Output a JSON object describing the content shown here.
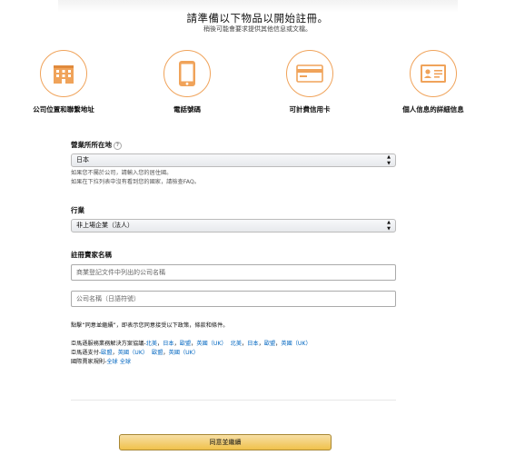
{
  "header": {
    "title": "請準備以下物品以開始註冊。",
    "subtitle": "稍後可能會要求提供其他信息或文檔。"
  },
  "steps": [
    {
      "label": "公司位置和聯繫地址",
      "icon": "building-icon"
    },
    {
      "label": "電話號碼",
      "icon": "phone-icon"
    },
    {
      "label": "可計費信用卡",
      "icon": "credit-card-icon"
    },
    {
      "label": "個人信息的詳細信息",
      "icon": "id-card-icon"
    }
  ],
  "business_location": {
    "label": "營業所所在地",
    "help_icon": "?",
    "selected": "日本",
    "hint_1": "如果您不屬於公司，請輸入您的居住國。",
    "hint_2": "如果在下拉列表中沒有看到您的國家，請檢查FAQ。"
  },
  "industry": {
    "label": "行業",
    "selected": "非上場企業（法人）"
  },
  "seller_name": {
    "label": "註冊賣家名稱",
    "placeholder_1": "商業登記文件中列出的公司名稱",
    "placeholder_2": "公司名稱（日語符號）"
  },
  "legal": {
    "intro": "點擊“同意並繼續”，即表示您同意接受以下政策，條款和條件。",
    "line1_prefix": "亞馬遜服務業務解決方案協議-",
    "line1_links": [
      "北美",
      "日本",
      "歐盟",
      "英國（UK）",
      "北美",
      "日本",
      "歐盟",
      "英國（UK）"
    ],
    "line2_prefix": "亞馬遜支付-",
    "line2_links": [
      "歐盟",
      "英國（UK）",
      "歐盟",
      "英國（UK）"
    ],
    "line3_prefix": "國際賣家規則-",
    "line3_links": [
      "全球",
      "全球"
    ]
  },
  "continue_button": {
    "label": "同意並繼續"
  },
  "colors": {
    "accent": "#f0a35a",
    "link": "#0066c0",
    "button": "#f0c14b"
  }
}
